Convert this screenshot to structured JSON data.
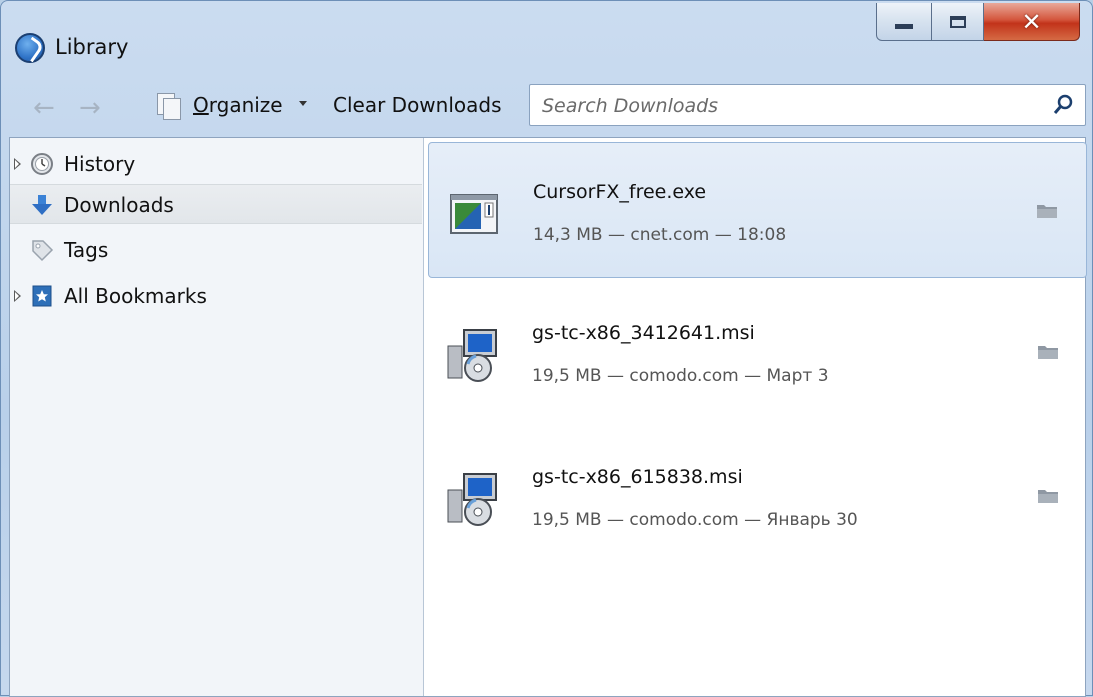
{
  "window": {
    "title": "Library"
  },
  "toolbar": {
    "back_icon": "back-arrow-icon",
    "forward_icon": "forward-arrow-icon",
    "organize_label_first": "O",
    "organize_label_rest": "rganize",
    "clear_downloads_label": "Clear Downloads",
    "search_placeholder": "Search Downloads"
  },
  "sidebar": {
    "items": [
      {
        "label": "History",
        "icon": "clock-icon",
        "expandable": true,
        "selected": false
      },
      {
        "label": "Downloads",
        "icon": "download-arrow-icon",
        "expandable": false,
        "selected": true
      },
      {
        "label": "Tags",
        "icon": "tag-icon",
        "expandable": false,
        "selected": false
      },
      {
        "label": "All Bookmarks",
        "icon": "bookmark-star-icon",
        "expandable": true,
        "selected": false
      }
    ]
  },
  "downloads": [
    {
      "name": "CursorFX_free.exe",
      "status": "14,3 MB — cnet.com — 18:08",
      "icon": "exe-window-icon",
      "selected": true
    },
    {
      "name": "gs-tc-x86_3412641.msi",
      "status": "19,5 MB — comodo.com — Март 3",
      "icon": "msi-installer-icon",
      "selected": false
    },
    {
      "name": "gs-tc-x86_615838.msi",
      "status": "19,5 MB — comodo.com — Январь 30",
      "icon": "msi-installer-icon",
      "selected": false
    }
  ],
  "colors": {
    "selection": "#d9e6f5",
    "close_button": "#c2331a"
  }
}
